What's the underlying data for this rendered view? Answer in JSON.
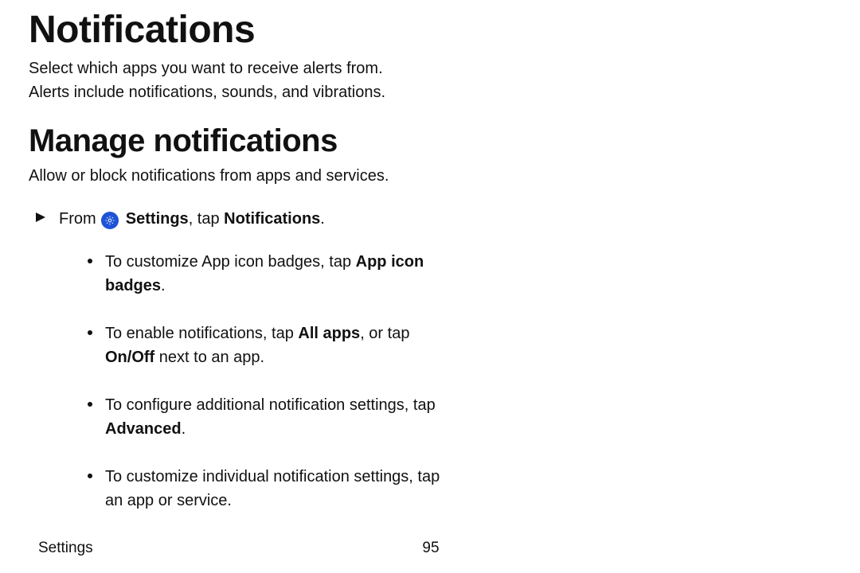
{
  "h1": "Notifications",
  "intro1_line1": "Select which apps you want to receive alerts from.",
  "intro1_line2": "Alerts include notifications, sounds, and vibrations.",
  "h2": "Manage notifications",
  "intro2": "Allow or block notifications from apps and services.",
  "step": {
    "prefix": "From ",
    "settings_label": "Settings",
    "middle": ", tap ",
    "notifications_label": "Notifications",
    "suffix": "."
  },
  "bullets": {
    "b1": {
      "t1": "To customize App icon badges, tap ",
      "bold1": "App icon badges",
      "t2": "."
    },
    "b2": {
      "t1": "To enable notifications, tap ",
      "bold1": "All apps",
      "t2": ", or tap ",
      "bold2": "On/Off",
      "t3": " next to an app."
    },
    "b3": {
      "t1": "To configure additional notification settings, tap ",
      "bold1": "Advanced",
      "t2": "."
    },
    "b4": {
      "t1": "To customize individual notification settings, tap an app or service."
    }
  },
  "footer": {
    "section": "Settings",
    "page": "95"
  }
}
